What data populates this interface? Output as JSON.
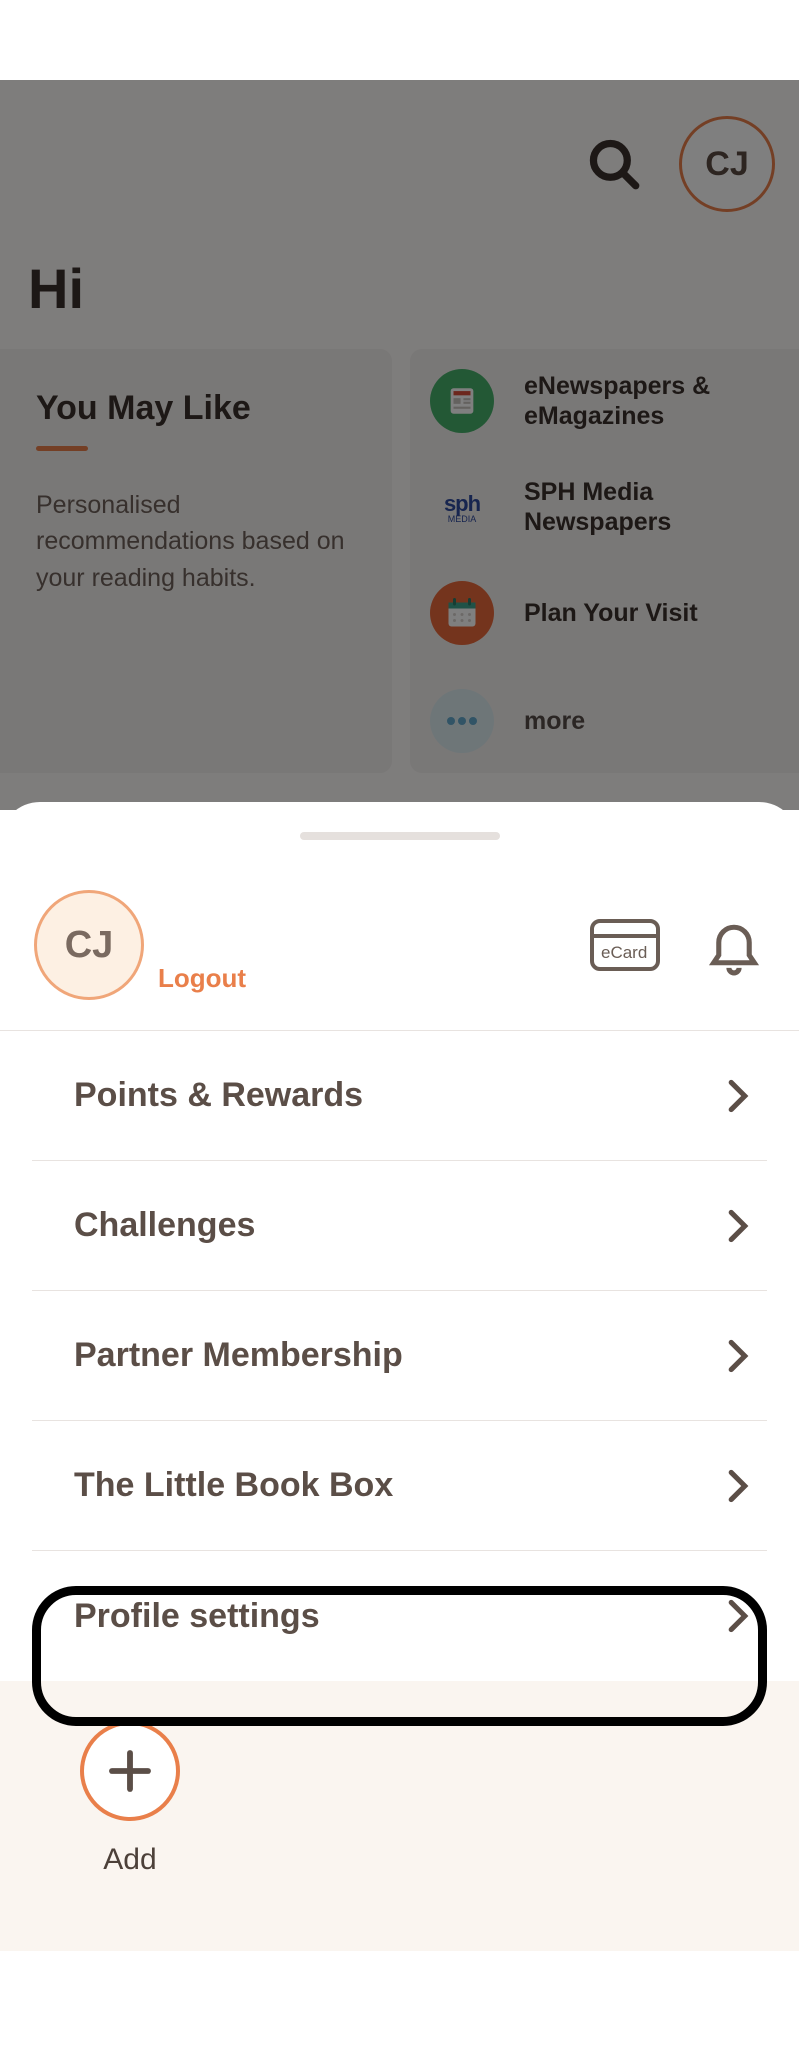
{
  "user": {
    "initials": "CJ"
  },
  "header": {
    "search_name": "search-icon"
  },
  "greeting": "Hi",
  "you_may_like": {
    "title": "You May Like",
    "desc": "Personalised recommendations based on your reading habits."
  },
  "shortcuts": [
    {
      "label": "eNewspapers & eMagazines"
    },
    {
      "label": "SPH Media Newspapers"
    },
    {
      "label": "Plan Your Visit"
    },
    {
      "label": "more"
    }
  ],
  "sheet": {
    "logout": "Logout",
    "ecard_text": "eCard",
    "menu": [
      {
        "label": "Points & Rewards"
      },
      {
        "label": "Challenges"
      },
      {
        "label": "Partner Membership"
      },
      {
        "label": "The Little Book Box"
      },
      {
        "label": "Profile settings"
      }
    ],
    "add_label": "Add"
  }
}
